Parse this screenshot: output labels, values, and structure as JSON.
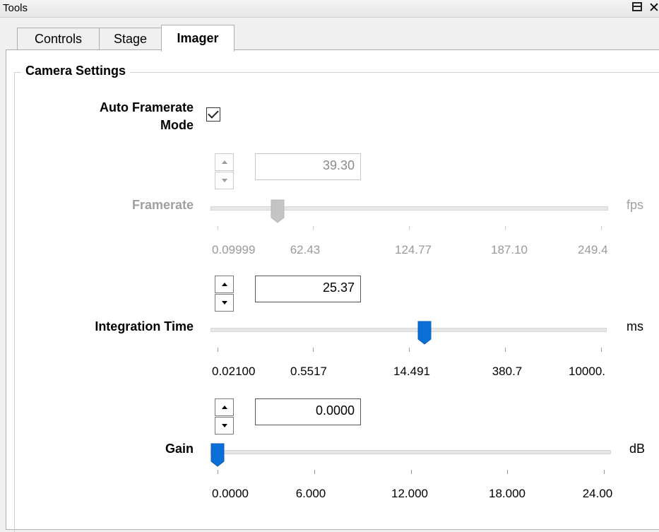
{
  "window": {
    "title": "Tools"
  },
  "tabs": [
    {
      "label": "Controls",
      "active": false
    },
    {
      "label": "Stage",
      "active": false
    },
    {
      "label": "Imager",
      "active": true
    }
  ],
  "group": {
    "title": "Camera Settings"
  },
  "auto_framerate": {
    "label_line1": "Auto Framerate",
    "label_line2": "Mode",
    "checked": true
  },
  "framerate": {
    "label": "Framerate",
    "value": "39.30",
    "unit": "fps",
    "enabled": false,
    "slider_position": 0.16,
    "ticks": [
      "0.09999",
      "62.43",
      "124.77",
      "187.10",
      "249.4"
    ]
  },
  "integration_time": {
    "label": "Integration Time",
    "value": "25.37",
    "unit": "ms",
    "enabled": true,
    "slider_position": 0.54,
    "ticks": [
      "0.02100",
      "0.5517",
      "14.491",
      "380.7",
      "10000."
    ]
  },
  "gain": {
    "label": "Gain",
    "value": "0.0000",
    "unit": "dB",
    "enabled": true,
    "slider_position": 0.0,
    "ticks": [
      "0.0000",
      "6.000",
      "12.000",
      "18.000",
      "24.00"
    ]
  },
  "colors": {
    "thumb_active": "#0a6fd6",
    "thumb_disabled": "#c4c4c4",
    "disabled_text": "#a0a0a0"
  }
}
